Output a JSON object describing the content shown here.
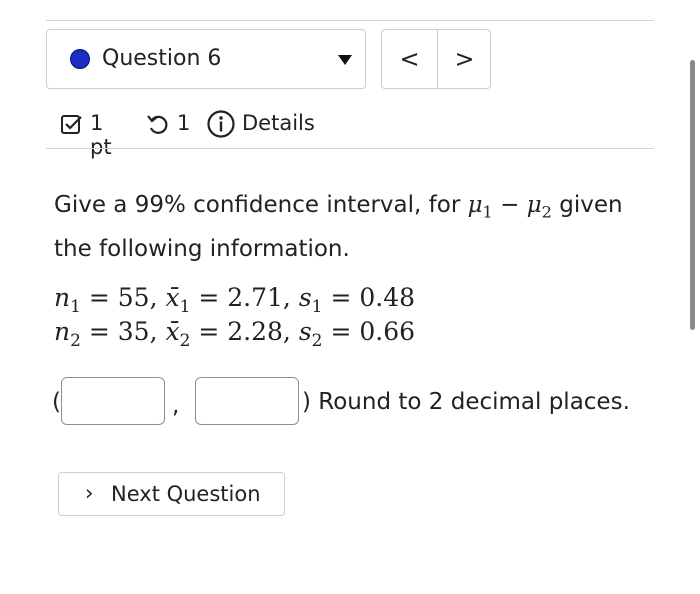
{
  "question_selector": {
    "label": "Question 6",
    "status_color": "#1b2bc4",
    "icon": "chevron-down-icon"
  },
  "nav": {
    "prev": "<",
    "next": ">"
  },
  "meta": {
    "points": "1 pt",
    "retries": "1",
    "details": "Details",
    "icons": [
      "checkbox-icon",
      "retry-icon",
      "info-icon"
    ]
  },
  "question": {
    "prompt_before": "Give a 99% confidence interval, for ",
    "mu1": "μ",
    "mu1_sub": "1",
    "minus": " − ",
    "mu2": "μ",
    "mu2_sub": "2",
    "prompt_after": " given the following information.",
    "line1": {
      "n_var": "n",
      "n_sub": "1",
      "n_val": " = 55, ",
      "x_var": "x̄",
      "x_sub": "1",
      "x_val": " = 2.71, ",
      "s_var": "s",
      "s_sub": "1",
      "s_val": " = 0.48"
    },
    "line2": {
      "n_var": "n",
      "n_sub": "2",
      "n_val": " = 35, ",
      "x_var": "x̄",
      "x_sub": "2",
      "x_val": " = 2.28, ",
      "s_var": "s",
      "s_sub": "2",
      "s_val": " = 0.66"
    }
  },
  "answer": {
    "open_paren": "(",
    "comma": ",",
    "lower_value": "",
    "upper_value": "",
    "instruction": ") Round to 2 decimal places."
  },
  "next_button": {
    "chevron": "›",
    "label": "Next Question"
  }
}
